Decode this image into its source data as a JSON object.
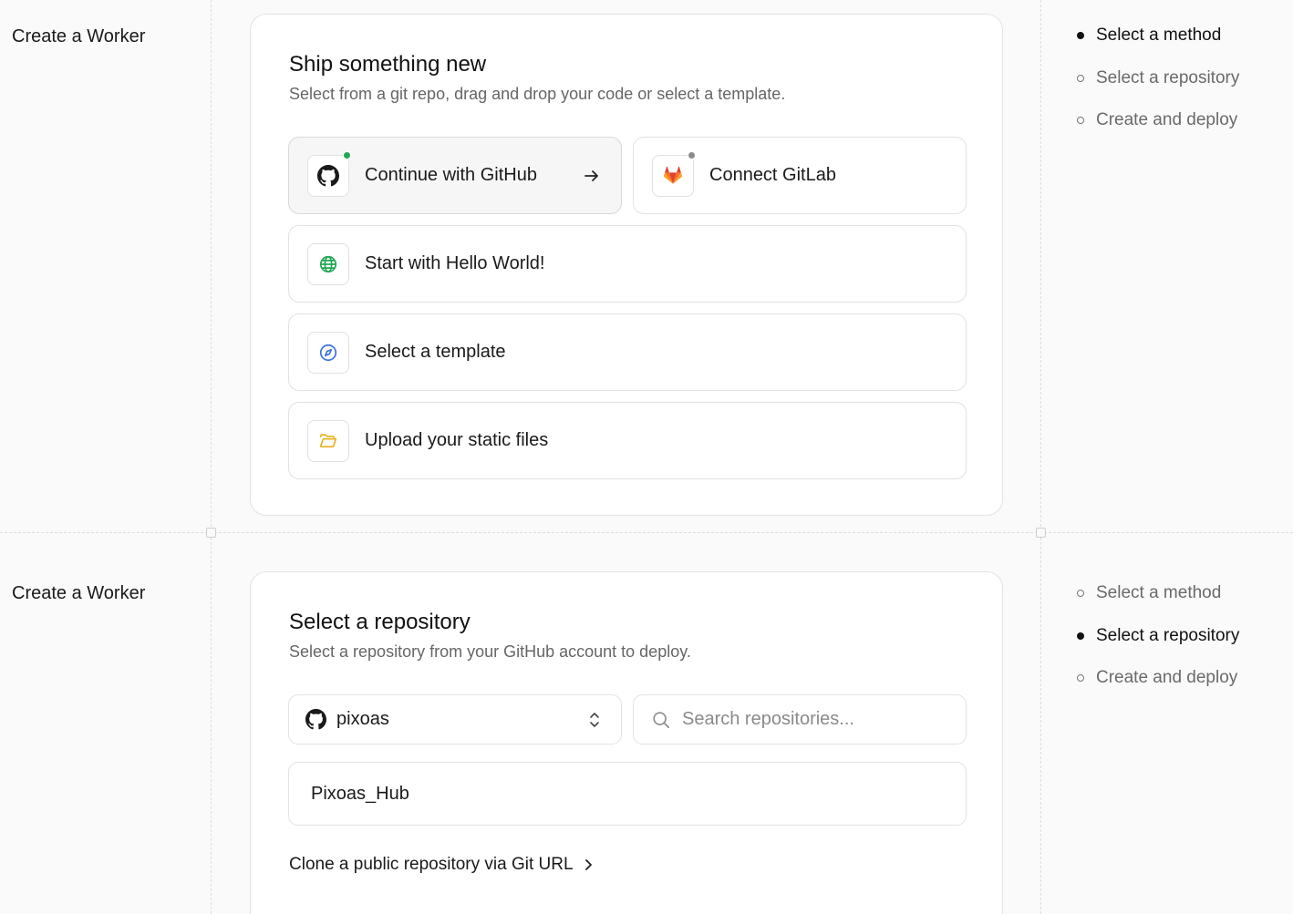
{
  "top": {
    "section_title": "Create a Worker",
    "card": {
      "title": "Ship something new",
      "subtitle": "Select from a git repo, drag and drop your code or select a template.",
      "options": [
        {
          "label": "Continue with GitHub",
          "icon": "github-icon",
          "status_color": "#22a652"
        },
        {
          "label": "Connect GitLab",
          "icon": "gitlab-icon",
          "status_color": "#8a8a8a"
        },
        {
          "label": "Start with Hello World!",
          "icon": "globe-icon"
        },
        {
          "label": "Select a template",
          "icon": "compass-icon"
        },
        {
          "label": "Upload your static files",
          "icon": "folder-icon"
        }
      ]
    },
    "steps": [
      {
        "label": "Select a method",
        "current": true
      },
      {
        "label": "Select a repository",
        "current": false
      },
      {
        "label": "Create and deploy",
        "current": false
      }
    ]
  },
  "bottom": {
    "section_title": "Create a Worker",
    "card": {
      "title": "Select a repository",
      "subtitle": "Select a repository from your GitHub account to deploy.",
      "account_select": {
        "value": "pixoas",
        "icon": "github-icon"
      },
      "search": {
        "placeholder": "Search repositories...",
        "value": ""
      },
      "repos": [
        "Pixoas_Hub"
      ],
      "clone_link": "Clone a public repository via Git URL"
    },
    "steps": [
      {
        "label": "Select a method",
        "current": false
      },
      {
        "label": "Select a repository",
        "current": true
      },
      {
        "label": "Create and deploy",
        "current": false
      }
    ]
  },
  "colors": {
    "accent_green": "#22a652",
    "gitlab_orange": "#e24329",
    "template_blue": "#3b6fe0",
    "folder_yellow": "#e8b21d"
  }
}
